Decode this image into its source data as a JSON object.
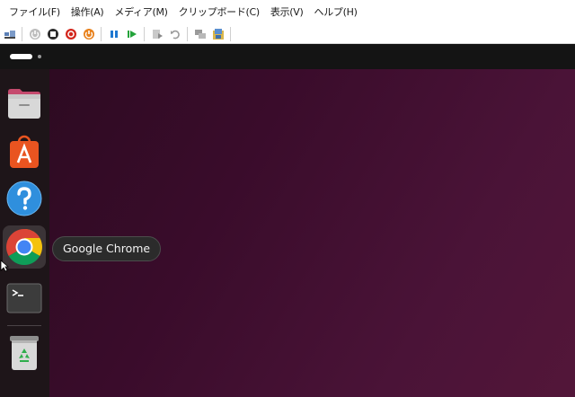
{
  "menubar": {
    "items": [
      {
        "label": "ファイル(F)"
      },
      {
        "label": "操作(A)"
      },
      {
        "label": "メディア(M)"
      },
      {
        "label": "クリップボード(C)"
      },
      {
        "label": "表示(V)"
      },
      {
        "label": "ヘルプ(H)"
      }
    ]
  },
  "toolbar": {
    "icons": [
      "ctrl-alt-del-icon",
      "start-icon",
      "turn-off-icon",
      "shut-down-icon",
      "power-icon",
      "pause-icon",
      "resume-icon",
      "checkpoint-icon",
      "revert-icon",
      "enhanced-session-icon",
      "share-icon"
    ]
  },
  "dock": {
    "items": [
      {
        "name": "Files",
        "icon": "folder-icon"
      },
      {
        "name": "Ubuntu Software",
        "icon": "app-center-icon"
      },
      {
        "name": "Help",
        "icon": "help-icon"
      },
      {
        "name": "Google Chrome",
        "icon": "chrome-icon",
        "active": true
      },
      {
        "name": "Terminal",
        "icon": "terminal-icon"
      },
      {
        "name": "Trash",
        "icon": "trash-icon"
      }
    ]
  },
  "tooltip": {
    "text": "Google Chrome"
  },
  "colors": {
    "accent_orange": "#e95420",
    "chrome_red": "#db4437",
    "chrome_yellow": "#f4c20d",
    "chrome_green": "#0f9d58",
    "chrome_blue": "#4285f4"
  }
}
